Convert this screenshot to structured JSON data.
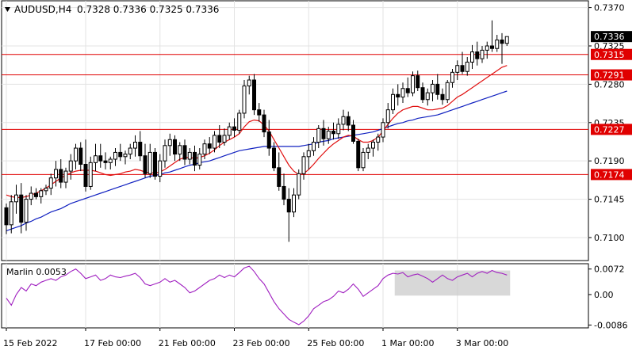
{
  "header": {
    "symbol_label": "AUDUSD,H4",
    "ohlc_label": "0.7328 0.7336 0.7325 0.7336",
    "dropdown_icon": "triangle-down-icon"
  },
  "colors": {
    "background": "#ffffff",
    "grid": "#e3e3e3",
    "axis": "#000000",
    "candle": "#000000",
    "level_line": "#e00000",
    "ma_fast": "#e01010",
    "ma_slow": "#1020c0",
    "oscillator": "#a020c0",
    "highlight": "#c8c8c8",
    "price_tag_bg": "#000000",
    "level_tag_bg": "#e00000"
  },
  "price_panel": {
    "ylim": [
      0.7073,
      0.7378
    ],
    "y_ticks": [
      "0.7370",
      "0.7325",
      "0.7280",
      "0.7235",
      "0.7190",
      "0.7145",
      "0.7100"
    ],
    "current_price": "0.7336",
    "levels": [
      {
        "value": 0.7315,
        "label": "0.7315"
      },
      {
        "value": 0.7291,
        "label": "0.7291"
      },
      {
        "value": 0.7227,
        "label": "0.7227"
      },
      {
        "value": 0.7174,
        "label": "0.7174"
      }
    ]
  },
  "indicator_panel": {
    "name_label": "Marlin 0.0053",
    "ylim": [
      -0.0094,
      0.0087
    ],
    "y_ticks": [
      "0.0072",
      "0.00",
      "-0.0086"
    ]
  },
  "x_axis": {
    "labels": [
      "15 Feb 2022",
      "17 Feb 00:00",
      "21 Feb 00:00",
      "23 Feb 00:00",
      "25 Feb 00:00",
      "1 Mar 00:00",
      "3 Mar 00:00"
    ],
    "label_bar_index": [
      0,
      16,
      31,
      46,
      61,
      76,
      91
    ]
  },
  "chart_data": {
    "type": "candlestick",
    "title": "AUDUSD,H4",
    "timeframe": "H4",
    "ohlc": [
      [
        0.7135,
        0.714,
        0.7104,
        0.7115
      ],
      [
        0.7115,
        0.715,
        0.7105,
        0.7142
      ],
      [
        0.7142,
        0.7162,
        0.7128,
        0.715
      ],
      [
        0.715,
        0.7164,
        0.7105,
        0.7118
      ],
      [
        0.7118,
        0.715,
        0.7108,
        0.7145
      ],
      [
        0.7145,
        0.716,
        0.7138,
        0.7152
      ],
      [
        0.7152,
        0.7158,
        0.7145,
        0.7148
      ],
      [
        0.7148,
        0.7158,
        0.714,
        0.7155
      ],
      [
        0.7155,
        0.7162,
        0.715,
        0.7158
      ],
      [
        0.7158,
        0.7175,
        0.715,
        0.717
      ],
      [
        0.717,
        0.719,
        0.716,
        0.718
      ],
      [
        0.718,
        0.7192,
        0.7158,
        0.7165
      ],
      [
        0.7165,
        0.7182,
        0.7158,
        0.7178
      ],
      [
        0.7178,
        0.7198,
        0.7168,
        0.719
      ],
      [
        0.719,
        0.721,
        0.718,
        0.7205
      ],
      [
        0.7205,
        0.7212,
        0.7178,
        0.7186
      ],
      [
        0.7186,
        0.7215,
        0.7154,
        0.716
      ],
      [
        0.716,
        0.7195,
        0.7156,
        0.7188
      ],
      [
        0.7188,
        0.721,
        0.7178,
        0.7196
      ],
      [
        0.7196,
        0.721,
        0.7182,
        0.719
      ],
      [
        0.719,
        0.72,
        0.718,
        0.7188
      ],
      [
        0.7188,
        0.7195,
        0.718,
        0.7192
      ],
      [
        0.7192,
        0.7205,
        0.7184,
        0.72
      ],
      [
        0.72,
        0.721,
        0.719,
        0.7195
      ],
      [
        0.7195,
        0.7202,
        0.7186,
        0.7198
      ],
      [
        0.7198,
        0.721,
        0.7192,
        0.7205
      ],
      [
        0.7205,
        0.722,
        0.7195,
        0.7212
      ],
      [
        0.7212,
        0.7225,
        0.719,
        0.7196
      ],
      [
        0.7196,
        0.721,
        0.717,
        0.7175
      ],
      [
        0.7175,
        0.721,
        0.717,
        0.72
      ],
      [
        0.72,
        0.7205,
        0.7168,
        0.7172
      ],
      [
        0.7172,
        0.7198,
        0.7165,
        0.719
      ],
      [
        0.719,
        0.7215,
        0.7182,
        0.7208
      ],
      [
        0.7208,
        0.7222,
        0.7196,
        0.7215
      ],
      [
        0.7215,
        0.722,
        0.719,
        0.7198
      ],
      [
        0.7198,
        0.7212,
        0.719,
        0.7208
      ],
      [
        0.7208,
        0.7215,
        0.7185,
        0.7192
      ],
      [
        0.7192,
        0.7205,
        0.7186,
        0.72
      ],
      [
        0.72,
        0.7208,
        0.7178,
        0.7185
      ],
      [
        0.7185,
        0.7205,
        0.718,
        0.7198
      ],
      [
        0.7198,
        0.7215,
        0.7192,
        0.721
      ],
      [
        0.721,
        0.7218,
        0.7198,
        0.7205
      ],
      [
        0.7205,
        0.7225,
        0.72,
        0.722
      ],
      [
        0.722,
        0.7232,
        0.7205,
        0.7212
      ],
      [
        0.7212,
        0.7228,
        0.7208,
        0.722
      ],
      [
        0.722,
        0.7235,
        0.7215,
        0.723
      ],
      [
        0.723,
        0.724,
        0.7218,
        0.7226
      ],
      [
        0.7226,
        0.725,
        0.7222,
        0.7246
      ],
      [
        0.7246,
        0.7285,
        0.724,
        0.7278
      ],
      [
        0.7278,
        0.729,
        0.7268,
        0.7285
      ],
      [
        0.7285,
        0.7292,
        0.7244,
        0.725
      ],
      [
        0.725,
        0.7258,
        0.7236,
        0.7244
      ],
      [
        0.7244,
        0.725,
        0.7218,
        0.7224
      ],
      [
        0.7224,
        0.7238,
        0.7196,
        0.7205
      ],
      [
        0.7205,
        0.7212,
        0.7178,
        0.7182
      ],
      [
        0.7182,
        0.72,
        0.7155,
        0.716
      ],
      [
        0.716,
        0.7175,
        0.7138,
        0.7145
      ],
      [
        0.7145,
        0.7158,
        0.7095,
        0.713
      ],
      [
        0.713,
        0.7158,
        0.7124,
        0.715
      ],
      [
        0.715,
        0.718,
        0.7145,
        0.7175
      ],
      [
        0.7175,
        0.72,
        0.7168,
        0.7195
      ],
      [
        0.7195,
        0.721,
        0.718,
        0.7202
      ],
      [
        0.7202,
        0.7218,
        0.7196,
        0.7212
      ],
      [
        0.7212,
        0.7232,
        0.7205,
        0.7228
      ],
      [
        0.7228,
        0.7238,
        0.7208,
        0.7216
      ],
      [
        0.7216,
        0.723,
        0.721,
        0.7225
      ],
      [
        0.7225,
        0.7235,
        0.7215,
        0.7222
      ],
      [
        0.7222,
        0.724,
        0.7216,
        0.7233
      ],
      [
        0.7233,
        0.725,
        0.7226,
        0.7242
      ],
      [
        0.7242,
        0.7248,
        0.7225,
        0.7232
      ],
      [
        0.7232,
        0.7238,
        0.721,
        0.7213
      ],
      [
        0.7213,
        0.7216,
        0.7178,
        0.7182
      ],
      [
        0.7182,
        0.7205,
        0.7178,
        0.72
      ],
      [
        0.72,
        0.721,
        0.7192,
        0.7205
      ],
      [
        0.7205,
        0.7215,
        0.7195,
        0.7212
      ],
      [
        0.7212,
        0.7222,
        0.7202,
        0.7218
      ],
      [
        0.7218,
        0.724,
        0.7212,
        0.7235
      ],
      [
        0.7235,
        0.7258,
        0.7228,
        0.725
      ],
      [
        0.725,
        0.7275,
        0.7245,
        0.7268
      ],
      [
        0.7268,
        0.728,
        0.7255,
        0.7265
      ],
      [
        0.7265,
        0.7282,
        0.7258,
        0.7275
      ],
      [
        0.7275,
        0.7288,
        0.7265,
        0.727
      ],
      [
        0.727,
        0.7295,
        0.7266,
        0.729
      ],
      [
        0.729,
        0.7296,
        0.7272,
        0.7276
      ],
      [
        0.7276,
        0.7282,
        0.7258,
        0.7262
      ],
      [
        0.7262,
        0.7275,
        0.7255,
        0.727
      ],
      [
        0.727,
        0.7285,
        0.726,
        0.728
      ],
      [
        0.728,
        0.7292,
        0.7262,
        0.7268
      ],
      [
        0.7268,
        0.7275,
        0.7256,
        0.7262
      ],
      [
        0.7262,
        0.7285,
        0.7258,
        0.7282
      ],
      [
        0.7282,
        0.7298,
        0.7276,
        0.7294
      ],
      [
        0.7294,
        0.7308,
        0.7285,
        0.7302
      ],
      [
        0.7302,
        0.7318,
        0.7292,
        0.7295
      ],
      [
        0.7295,
        0.7312,
        0.729,
        0.7306
      ],
      [
        0.7306,
        0.7326,
        0.7298,
        0.7318
      ],
      [
        0.7318,
        0.733,
        0.7302,
        0.731
      ],
      [
        0.731,
        0.7325,
        0.7305,
        0.732
      ],
      [
        0.732,
        0.733,
        0.731,
        0.7325
      ],
      [
        0.7325,
        0.7355,
        0.7318,
        0.7322
      ],
      [
        0.7322,
        0.7338,
        0.7318,
        0.7332
      ],
      [
        0.7332,
        0.734,
        0.7304,
        0.7328
      ],
      [
        0.7328,
        0.7336,
        0.7325,
        0.7336
      ]
    ],
    "ma_fast": [
      0.715,
      0.7148,
      0.7147,
      0.7147,
      0.7148,
      0.715,
      0.7152,
      0.7155,
      0.7158,
      0.7162,
      0.7166,
      0.717,
      0.7173,
      0.7176,
      0.7178,
      0.7179,
      0.7179,
      0.7179,
      0.7178,
      0.7176,
      0.7174,
      0.7173,
      0.7174,
      0.7175,
      0.7177,
      0.7178,
      0.718,
      0.7179,
      0.7177,
      0.7176,
      0.7176,
      0.7177,
      0.718,
      0.7184,
      0.7188,
      0.7192,
      0.7194,
      0.7194,
      0.7193,
      0.7194,
      0.7196,
      0.7199,
      0.7203,
      0.7208,
      0.7212,
      0.7215,
      0.7218,
      0.7222,
      0.723,
      0.7236,
      0.7238,
      0.7237,
      0.7232,
      0.7225,
      0.7215,
      0.7205,
      0.7195,
      0.7185,
      0.7178,
      0.7174,
      0.7175,
      0.718,
      0.7186,
      0.7193,
      0.7199,
      0.7205,
      0.721,
      0.7214,
      0.7218,
      0.722,
      0.7219,
      0.7215,
      0.7212,
      0.7212,
      0.7214,
      0.7218,
      0.7225,
      0.7233,
      0.724,
      0.7246,
      0.725,
      0.7252,
      0.7254,
      0.7254,
      0.7252,
      0.725,
      0.725,
      0.7251,
      0.7252,
      0.7255,
      0.726,
      0.7265,
      0.7268,
      0.7272,
      0.7276,
      0.728,
      0.7284,
      0.7288,
      0.7292,
      0.7296,
      0.73,
      0.7302
    ],
    "ma_slow": [
      0.7108,
      0.711,
      0.7112,
      0.7114,
      0.7117,
      0.7119,
      0.7122,
      0.7124,
      0.7127,
      0.713,
      0.7132,
      0.7134,
      0.7137,
      0.714,
      0.7142,
      0.7144,
      0.7146,
      0.7148,
      0.715,
      0.7152,
      0.7154,
      0.7156,
      0.7158,
      0.716,
      0.7162,
      0.7164,
      0.7166,
      0.7168,
      0.717,
      0.7172,
      0.7173,
      0.7174,
      0.7176,
      0.7177,
      0.7179,
      0.7181,
      0.7183,
      0.7185,
      0.7186,
      0.7188,
      0.7189,
      0.719,
      0.7192,
      0.7194,
      0.7196,
      0.7198,
      0.72,
      0.7202,
      0.7203,
      0.7204,
      0.7205,
      0.7206,
      0.7207,
      0.7207,
      0.7207,
      0.7207,
      0.7207,
      0.7207,
      0.7207,
      0.7207,
      0.7208,
      0.7209,
      0.721,
      0.7212,
      0.7213,
      0.7214,
      0.7216,
      0.7217,
      0.7218,
      0.7219,
      0.722,
      0.7221,
      0.7222,
      0.7223,
      0.7224,
      0.7226,
      0.7228,
      0.723,
      0.7232,
      0.7234,
      0.7235,
      0.7237,
      0.7238,
      0.724,
      0.7241,
      0.7242,
      0.7243,
      0.7244,
      0.7246,
      0.7248,
      0.725,
      0.7252,
      0.7254,
      0.7256,
      0.7258,
      0.726,
      0.7262,
      0.7264,
      0.7266,
      0.7268,
      0.727,
      0.7272
    ],
    "oscillator": [
      -0.001,
      -0.003,
      0.0,
      0.002,
      0.001,
      0.003,
      0.0025,
      0.0035,
      0.004,
      0.0045,
      0.004,
      0.005,
      0.0055,
      0.0065,
      0.0072,
      0.006,
      0.0045,
      0.005,
      0.0055,
      0.004,
      0.0045,
      0.0055,
      0.005,
      0.0048,
      0.0052,
      0.0055,
      0.006,
      0.0048,
      0.003,
      0.0025,
      0.003,
      0.0035,
      0.0045,
      0.0035,
      0.004,
      0.003,
      0.002,
      0.0005,
      0.001,
      0.002,
      0.003,
      0.004,
      0.0045,
      0.0055,
      0.0048,
      0.0055,
      0.005,
      0.0062,
      0.0075,
      0.008,
      0.0065,
      0.0045,
      0.003,
      0.0005,
      -0.002,
      -0.004,
      -0.0055,
      -0.007,
      -0.0078,
      -0.0085,
      -0.0075,
      -0.006,
      -0.004,
      -0.003,
      -0.002,
      -0.0015,
      -0.0005,
      0.001,
      0.0005,
      0.0015,
      0.003,
      0.0015,
      -0.0005,
      0.0005,
      0.0015,
      0.0025,
      0.0045,
      0.0055,
      0.006,
      0.0058,
      0.0062,
      0.005,
      0.0055,
      0.0058,
      0.0052,
      0.0045,
      0.0035,
      0.0045,
      0.0055,
      0.0045,
      0.004,
      0.005,
      0.0055,
      0.006,
      0.005,
      0.006,
      0.0065,
      0.006,
      0.0068,
      0.0062,
      0.006,
      0.0055
    ],
    "highlight_range": {
      "from_bar": 79,
      "to_bar": 101,
      "from_value": -0.0003,
      "to_value": 0.0068
    }
  }
}
